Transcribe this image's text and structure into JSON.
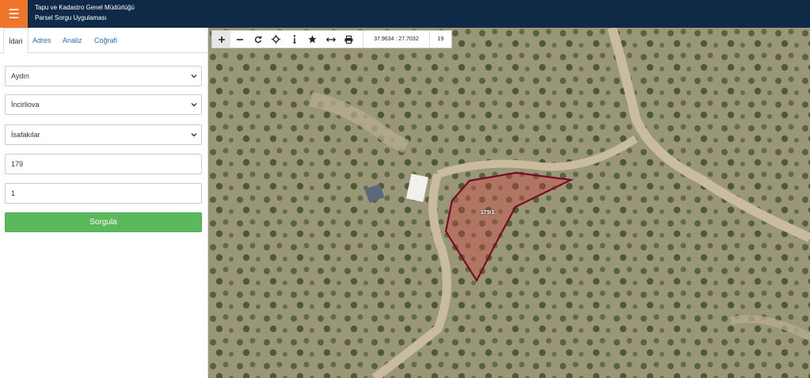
{
  "header": {
    "menu_icon": "hamburger-icon",
    "title_line1": "Tapu ve Kadastro Genel Müdürlüğü",
    "title_line2": "Parsel Sorgu Uygulaması"
  },
  "tabs": [
    {
      "label": "İdari"
    },
    {
      "label": "Adres"
    },
    {
      "label": "Analiz"
    },
    {
      "label": "Coğrafi"
    }
  ],
  "form": {
    "il": "Aydın",
    "ilce": "İncirliova",
    "mahalle": "İsafakılar",
    "ada": "179",
    "parsel": "1",
    "submit_label": "Sorgula"
  },
  "map": {
    "coords": "37.9634 : 27.7032",
    "zoom": "19",
    "parcel_label": "179/1",
    "parcel_color": "#7a0a2a"
  },
  "toolbar_icons": [
    "zoom-in-icon",
    "zoom-out-icon",
    "refresh-icon",
    "locate-icon",
    "info-icon",
    "favorite-icon",
    "measure-icon",
    "print-icon"
  ]
}
